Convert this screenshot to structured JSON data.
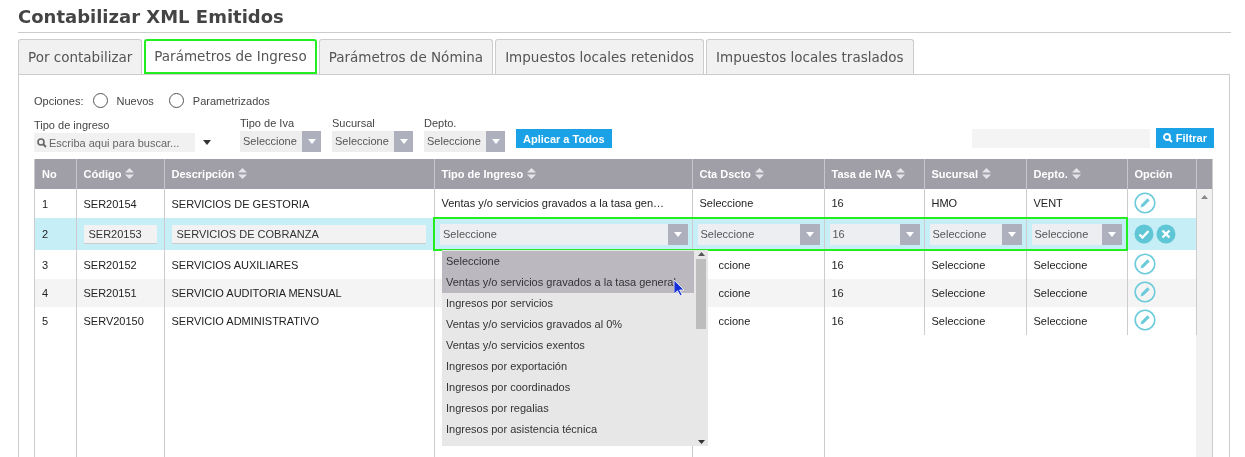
{
  "page_title": "Contabilizar XML Emitidos",
  "tabs": [
    {
      "label": "Por contabilizar",
      "selected": false
    },
    {
      "label": "Parámetros de Ingreso",
      "selected": true
    },
    {
      "label": "Parámetros de Nómina",
      "selected": false
    },
    {
      "label": "Impuestos locales retenidos",
      "selected": false
    },
    {
      "label": "Impuestos locales traslados",
      "selected": false
    }
  ],
  "options": {
    "label": "Opciones:",
    "radios": [
      {
        "label": "Nuevos",
        "checked": false
      },
      {
        "label": "Parametrizados",
        "checked": false
      }
    ]
  },
  "filters": [
    {
      "kind": "search",
      "label": "Tipo de ingreso",
      "placeholder": "Escriba aqui para buscar..."
    },
    {
      "kind": "select",
      "label": "Tipo de Iva",
      "value": "Seleccione"
    },
    {
      "kind": "select",
      "label": "Sucursal",
      "value": "Seleccione"
    },
    {
      "kind": "select",
      "label": "Depto.",
      "value": "Seleccione"
    }
  ],
  "apply_button": "Aplicar a Todos",
  "filter_button": "Filtrar",
  "table": {
    "columns": [
      {
        "label": "No",
        "sortable": false
      },
      {
        "label": "Código",
        "sortable": true
      },
      {
        "label": "Descripción",
        "sortable": true
      },
      {
        "label": "Tipo de Ingreso",
        "sortable": true
      },
      {
        "label": "Cta Dscto",
        "sortable": true
      },
      {
        "label": "Tasa de IVA",
        "sortable": true
      },
      {
        "label": "Sucursal",
        "sortable": true
      },
      {
        "label": "Depto.",
        "sortable": true
      },
      {
        "label": "Opción",
        "sortable": false
      }
    ],
    "rows": [
      {
        "cells": [
          "1",
          "SER20154",
          "SERVICIOS DE GESTORIA",
          "Ventas y/o servicios gravados a la tasa gen…",
          "Seleccione",
          "16",
          "HMO",
          "VENT"
        ],
        "selected": false,
        "editing": false
      },
      {
        "cells": [
          "2",
          "SER20153",
          "SERVICIOS DE COBRANZA",
          "Seleccione",
          "Seleccione",
          "16",
          "Seleccione",
          "Seleccione"
        ],
        "selected": true,
        "editing": true
      },
      {
        "cells": [
          "3",
          "SER20152",
          "SERVICIOS AUXILIARES",
          "",
          "ccione",
          "16",
          "Seleccione",
          "Seleccione"
        ],
        "selected": false,
        "editing": false
      },
      {
        "cells": [
          "4",
          "SER20151",
          "SERVICIO AUDITORIA MENSUAL",
          "",
          "ccione",
          "16",
          "Seleccione",
          "Seleccione"
        ],
        "selected": false,
        "editing": false
      },
      {
        "cells": [
          "5",
          "SERV20150",
          "SERVICIO ADMINISTRATIVO",
          "",
          "ccione",
          "16",
          "Seleccione",
          "Seleccione"
        ],
        "selected": false,
        "editing": false
      }
    ]
  },
  "dropdown": {
    "options": [
      {
        "label": "Seleccione",
        "highlighted": true
      },
      {
        "label": "Ventas y/o servicios gravados a la tasa general",
        "highlighted": true
      },
      {
        "label": "Ingresos por servicios",
        "highlighted": false
      },
      {
        "label": "Ventas y/o servicios gravados al 0%",
        "highlighted": false
      },
      {
        "label": "Ventas y/o servicios exentos",
        "highlighted": false
      },
      {
        "label": "Ingresos por exportación",
        "highlighted": false
      },
      {
        "label": "Ingresos por coordinados",
        "highlighted": false
      },
      {
        "label": "Ingresos por regalias",
        "highlighted": false
      },
      {
        "label": "Ingresos por asistencia técnica",
        "highlighted": false
      }
    ]
  }
}
